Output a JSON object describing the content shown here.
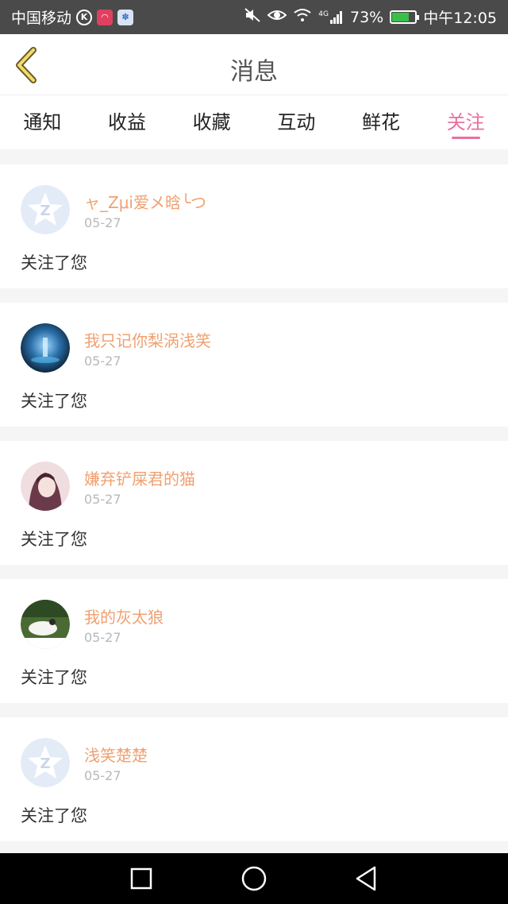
{
  "status_bar": {
    "carrier": "中国移动",
    "network": "4G",
    "battery": "73%",
    "battery_level": 0.73,
    "time": "中午12:05"
  },
  "header": {
    "title": "消息"
  },
  "tabs": [
    {
      "label": "通知",
      "active": false
    },
    {
      "label": "收益",
      "active": false
    },
    {
      "label": "收藏",
      "active": false
    },
    {
      "label": "互动",
      "active": false
    },
    {
      "label": "鲜花",
      "active": false
    },
    {
      "label": "关注",
      "active": true
    }
  ],
  "messages": [
    {
      "username": "ャ_Zμi爱メ晗╰つ",
      "date": "05-27",
      "text": "关注了您",
      "avatar": "default-avatar-icon"
    },
    {
      "username": "我只记你梨涡浅笑",
      "date": "05-27",
      "text": "关注了您",
      "avatar": "user-photo-avatar"
    },
    {
      "username": "嫌弃铲屎君的猫",
      "date": "05-27",
      "text": "关注了您",
      "avatar": "user-photo-avatar"
    },
    {
      "username": "我的灰太狼",
      "date": "05-27",
      "text": "关注了您",
      "avatar": "user-photo-avatar"
    },
    {
      "username": "浅笑楚楚",
      "date": "05-27",
      "text": "关注了您",
      "avatar": "default-avatar-icon"
    }
  ],
  "colors": {
    "accent": "#e870a0",
    "username": "#f0a070",
    "status_bar_bg": "#4a4a4a"
  }
}
